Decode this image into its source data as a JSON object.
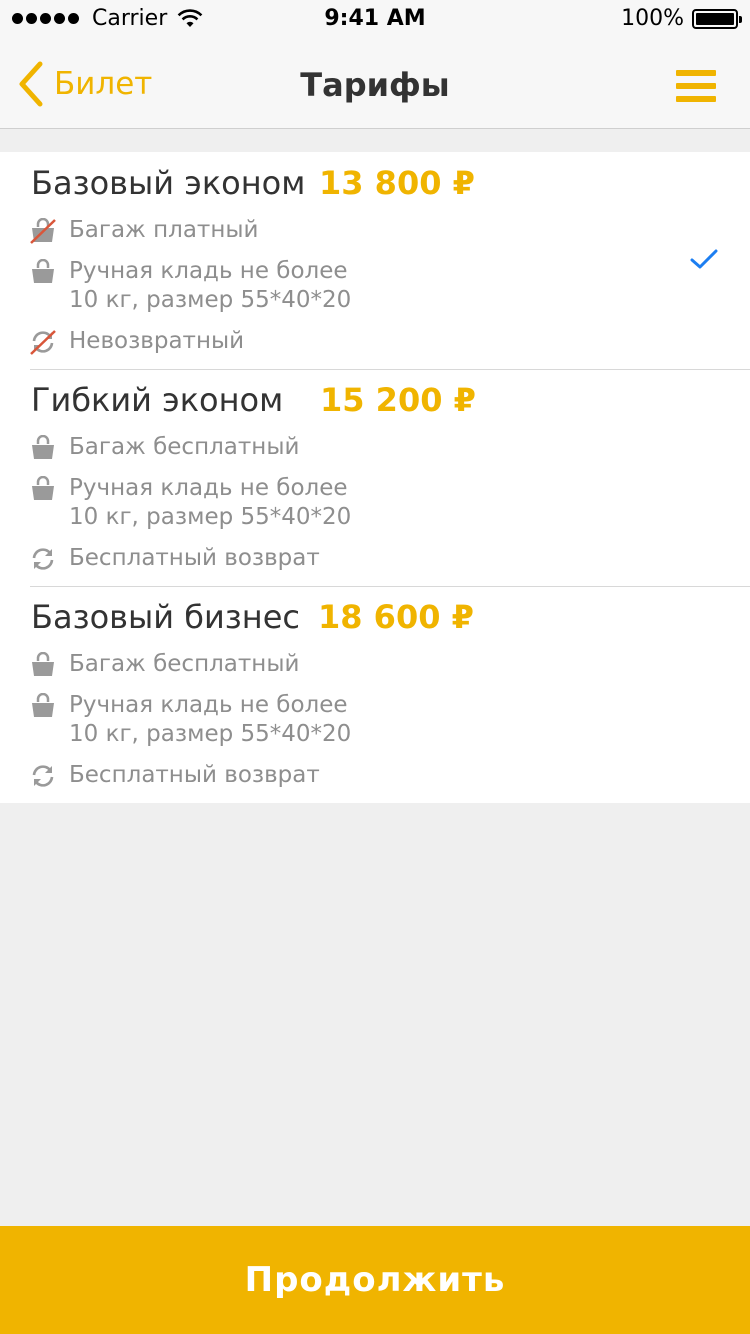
{
  "status_bar": {
    "carrier": "Carrier",
    "time": "9:41 AM",
    "battery": "100%"
  },
  "nav": {
    "back_label": "Билет",
    "title": "Тарифы"
  },
  "colors": {
    "accent": "#f0b400",
    "check": "#1c7ef1",
    "strike": "#d9563a"
  },
  "tariffs": [
    {
      "name": "Базовый эконом",
      "price": "13 800 ₽",
      "selected": true,
      "features": [
        {
          "icon": "bag-crossed-icon",
          "text": "Багаж платный"
        },
        {
          "icon": "bag-icon",
          "text": "Ручная кладь не более",
          "text2": "10 кг, размер 55*40*20"
        },
        {
          "icon": "refresh-crossed-icon",
          "text": "Невозвратный"
        }
      ]
    },
    {
      "name": "Гибкий эконом",
      "price": "15 200 ₽",
      "selected": false,
      "features": [
        {
          "icon": "bag-icon",
          "text": "Багаж бесплатный"
        },
        {
          "icon": "bag-icon",
          "text": "Ручная кладь не более",
          "text2": "10 кг, размер 55*40*20"
        },
        {
          "icon": "refresh-icon",
          "text": "Бесплатный возврат"
        }
      ]
    },
    {
      "name": "Базовый бизнес",
      "price": "18 600 ₽",
      "selected": false,
      "features": [
        {
          "icon": "bag-icon",
          "text": "Багаж бесплатный"
        },
        {
          "icon": "bag-icon",
          "text": "Ручная кладь не более",
          "text2": "10 кг, размер 55*40*20"
        },
        {
          "icon": "refresh-icon",
          "text": "Бесплатный возврат"
        }
      ]
    }
  ],
  "continue_label": "Продолжить"
}
